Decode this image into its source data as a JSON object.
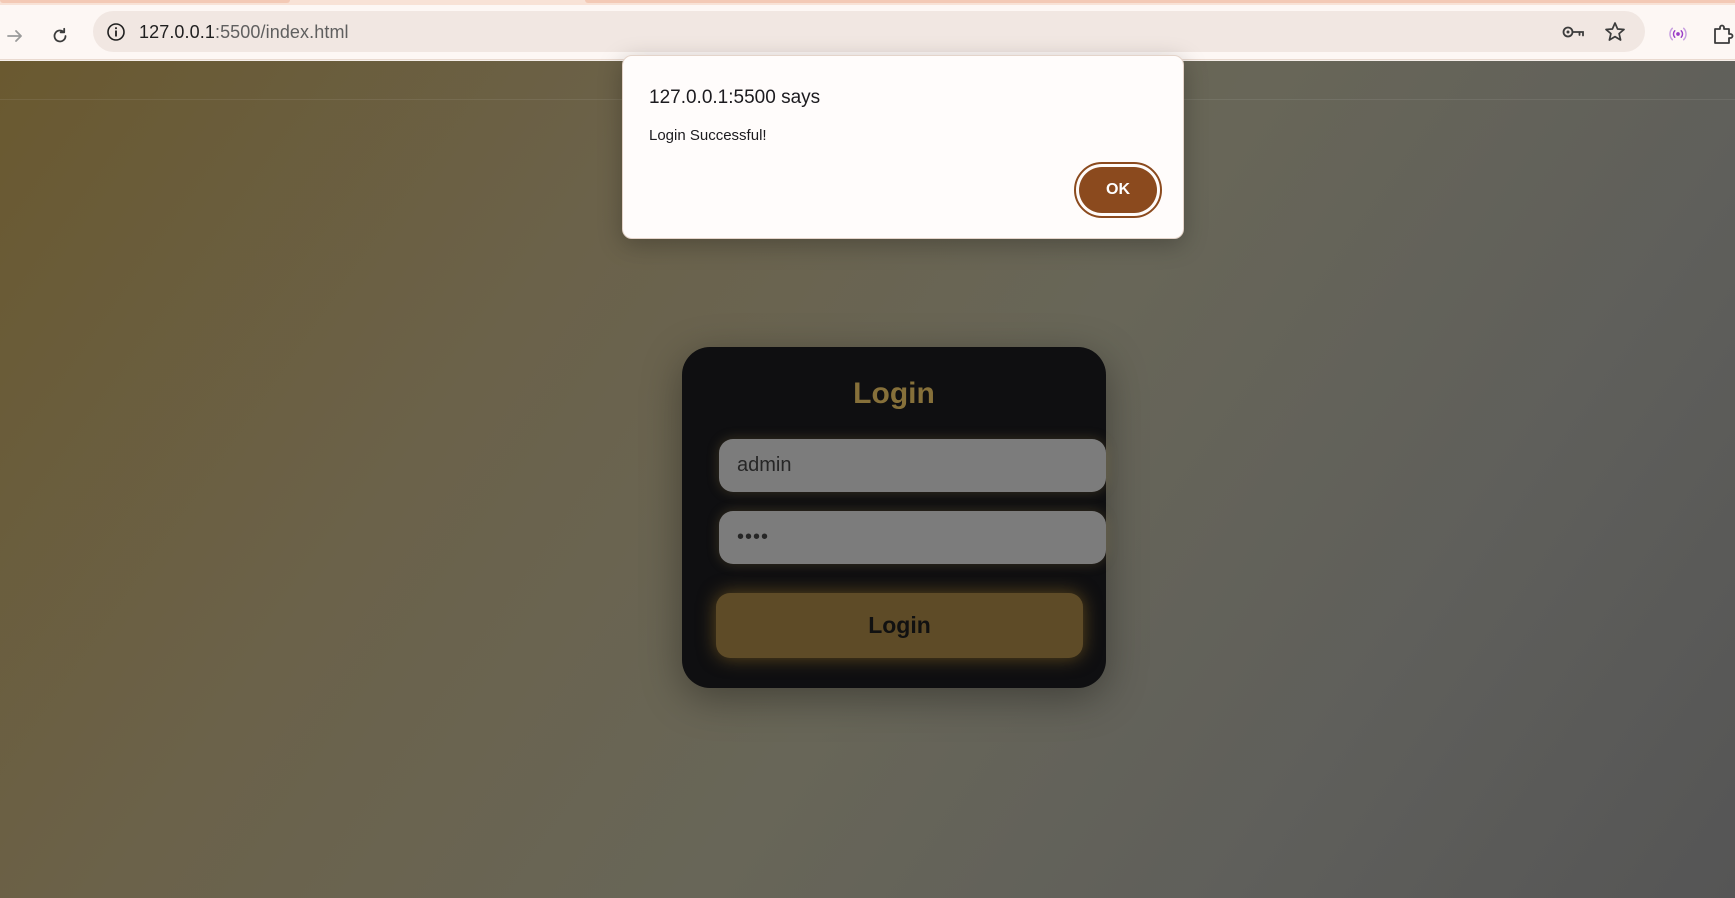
{
  "browser": {
    "url_host": "127.0.0.1",
    "url_rest": ":5500/index.html",
    "icons": {
      "forward": "arrow-right-icon",
      "reload": "reload-icon",
      "site_info": "info-icon",
      "passwords": "key-icon",
      "bookmark": "star-icon",
      "extension_broadcast": "broadcast-icon",
      "extensions": "puzzle-icon"
    }
  },
  "page": {
    "login_title": "Login",
    "username_value": "admin",
    "password_value": "••••",
    "login_button": "Login"
  },
  "dialog": {
    "title": "127.0.0.1:5500 says",
    "message": "Login Successful!",
    "ok_label": "OK"
  },
  "colors": {
    "accent_brown": "#8b4a1e",
    "gold_text": "#86703a",
    "button_gold": "#5e4b27",
    "card_bg": "#0f0f11"
  }
}
